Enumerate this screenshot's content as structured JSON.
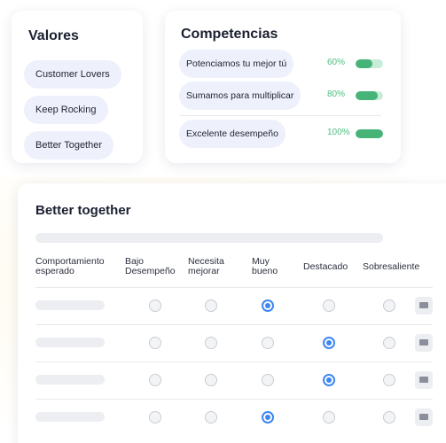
{
  "valores": {
    "title": "Valores",
    "items": [
      "Customer Lovers",
      "Keep Rocking",
      "Better Together"
    ]
  },
  "competencias": {
    "title": "Competencias",
    "items": [
      {
        "label": "Potenciamos tu mejor tú",
        "percent": "60%",
        "progress": 0.6
      },
      {
        "label": "Sumamos para multiplicar",
        "percent": "80%",
        "progress": 0.8
      },
      {
        "label": "Excelente desempeño",
        "percent": "100%",
        "progress": 1.0
      }
    ],
    "colors": {
      "bar_fill": "#47b477",
      "bar_track": "#c8ecd8",
      "percent_text": "#4cbf7e"
    }
  },
  "evaluation": {
    "title": "Better together",
    "columns": [
      {
        "line1": "Comportamiento",
        "line2": "esperado"
      },
      {
        "line1": "Bajo",
        "line2": "Desempeño"
      },
      {
        "line1": "Necesita",
        "line2": "mejorar"
      },
      {
        "line1": "Muy",
        "line2": "bueno"
      },
      {
        "line1": "Destacado",
        "line2": ""
      },
      {
        "line1": "Sobresaliente",
        "line2": ""
      }
    ],
    "rows": [
      {
        "selected_column": 3
      },
      {
        "selected_column": 4
      },
      {
        "selected_column": 4
      },
      {
        "selected_column": 3
      }
    ],
    "comment_icon": "comment-icon",
    "accent_color": "#3c86f3"
  }
}
